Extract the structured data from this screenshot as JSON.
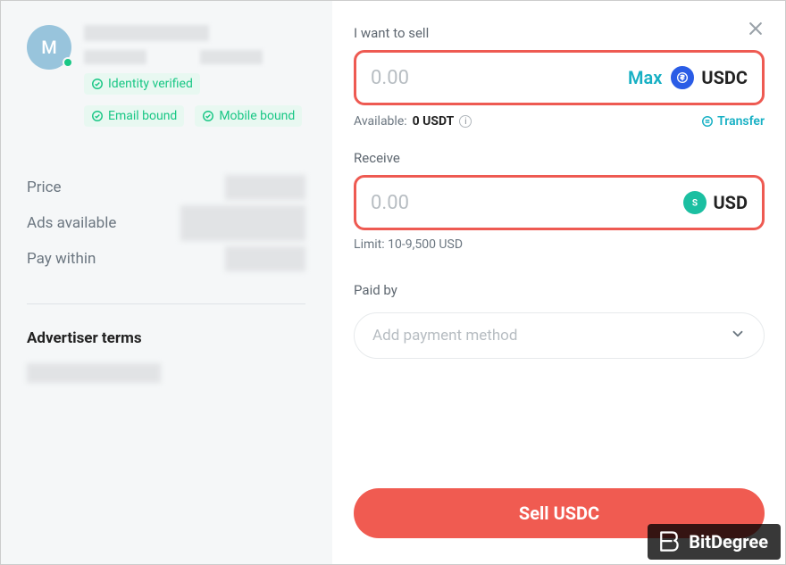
{
  "left": {
    "avatar_letter": "M",
    "badges": {
      "identity": "Identity verified",
      "email": "Email bound",
      "mobile": "Mobile bound"
    },
    "details": {
      "price_label": "Price",
      "ads_label": "Ads available",
      "pay_within_label": "Pay within"
    },
    "terms_heading": "Advertiser terms"
  },
  "sell": {
    "label": "I want to sell",
    "placeholder": "0.00",
    "max": "Max",
    "currency": "USDC",
    "available_prefix": "Available:",
    "available_value": "0 USDT",
    "transfer": "Transfer"
  },
  "receive": {
    "label": "Receive",
    "placeholder": "0.00",
    "currency": "USD",
    "limit": "Limit: 10-9,500 USD"
  },
  "paid_by": {
    "label": "Paid by",
    "placeholder": "Add payment method"
  },
  "submit": "Sell USDC",
  "watermark": "BitDegree"
}
